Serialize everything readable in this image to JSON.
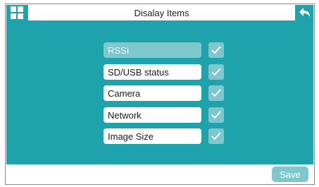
{
  "header": {
    "title": "Disalay Items",
    "menu_icon": "grid-icon",
    "back_icon": "back-arrow-icon"
  },
  "items": [
    {
      "label": "RSSI",
      "checked": true,
      "enabled": false
    },
    {
      "label": "SD/USB status",
      "checked": true,
      "enabled": true
    },
    {
      "label": "Camera",
      "checked": true,
      "enabled": true
    },
    {
      "label": "Network",
      "checked": true,
      "enabled": true
    },
    {
      "label": "Image Size",
      "checked": true,
      "enabled": true
    }
  ],
  "footer": {
    "save_label": "Save"
  },
  "colors": {
    "background": "#1ea2ab",
    "accent": "#7ec8cd",
    "surface": "#ffffff"
  }
}
